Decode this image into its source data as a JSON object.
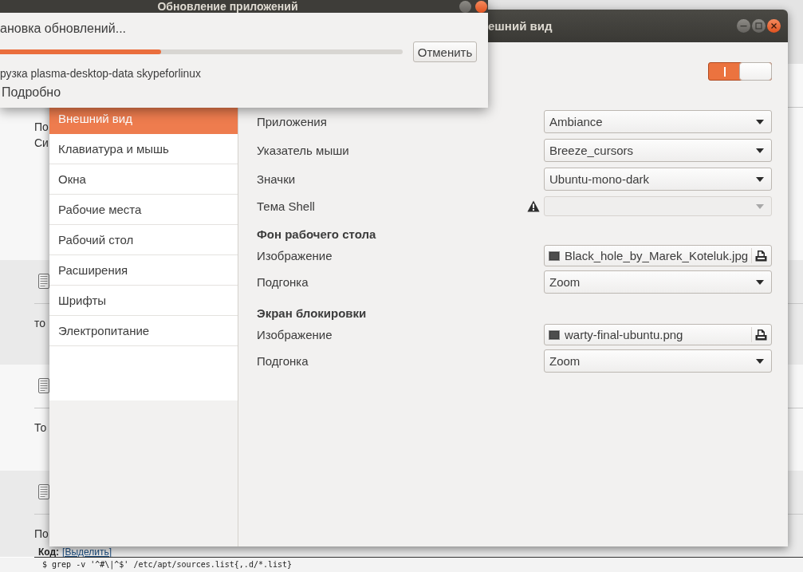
{
  "update_dialog": {
    "title": "Обновление приложений",
    "status": "ановка обновлений...",
    "progress": {
      "level": 0.4
    },
    "cancel_button": "Отменить",
    "detail": "рузка plasma-desktop-data skypeforlinux",
    "details_expander": "Подробно"
  },
  "tweak_window": {
    "title": "ешний вид",
    "header_switch": {
      "on": true
    },
    "sidebar": {
      "items": [
        {
          "label": "Внешний вид",
          "selected": true
        },
        {
          "label": "Клавиатура и мышь",
          "selected": false
        },
        {
          "label": "Окна",
          "selected": false
        },
        {
          "label": "Рабочие места",
          "selected": false
        },
        {
          "label": "Рабочий стол",
          "selected": false
        },
        {
          "label": "Расширения",
          "selected": false
        },
        {
          "label": "Шрифты",
          "selected": false
        },
        {
          "label": "Электропитание",
          "selected": false
        }
      ]
    },
    "settings": [
      {
        "kind": "combo",
        "label": "Приложения",
        "value": "Ambiance",
        "disabled": false,
        "warning": false
      },
      {
        "kind": "combo",
        "label": "Указатель мыши",
        "value": "Breeze_cursors",
        "disabled": false,
        "warning": false
      },
      {
        "kind": "combo",
        "label": "Значки",
        "value": "Ubuntu-mono-dark",
        "disabled": false,
        "warning": false
      },
      {
        "kind": "combo",
        "label": "Тема Shell",
        "disabled": true,
        "warning": true
      },
      {
        "kind": "heading",
        "label": "Фон рабочего стола"
      },
      {
        "kind": "file",
        "label": "Изображение",
        "value": "Black_hole_by_Marek_Koteluk.jpg"
      },
      {
        "kind": "combo",
        "label": "Подгонка",
        "value": "Zoom",
        "disabled": false,
        "warning": false
      },
      {
        "kind": "heading",
        "label": "Экран блокировки"
      },
      {
        "kind": "file",
        "label": "Изображение",
        "value": "warty-final-ubuntu.png"
      },
      {
        "kind": "combo",
        "label": "Подгонка",
        "value": "Zoom",
        "disabled": false,
        "warning": false
      }
    ]
  },
  "background_page": {
    "posts": [
      {
        "lines": [
          "По",
          "Си"
        ],
        "note_icon": false
      },
      {
        "lines": [
          "то"
        ],
        "note_icon": true
      },
      {
        "lines": [
          "То"
        ],
        "note_icon": true
      },
      {
        "lines": [
          "По"
        ],
        "note_icon": true
      }
    ],
    "code_block": {
      "label": "Код:",
      "select_link": "[Выделить]",
      "code": "$ grep -v '^#\\|^$' /etc/apt/sources.list{,.d/*.list}"
    }
  }
}
